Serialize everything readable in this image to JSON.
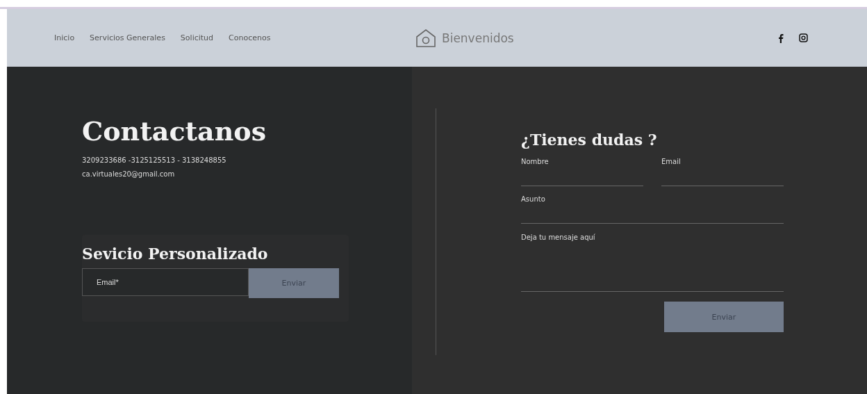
{
  "nav": {
    "links": [
      {
        "label": "Inicio"
      },
      {
        "label": "Servicios Generales"
      },
      {
        "label": "Solicitud"
      },
      {
        "label": "Conocenos"
      }
    ],
    "brand": "Bienvenidos"
  },
  "contact": {
    "title": "Contactanos",
    "phones": "3209233686 -3125125513 - 3138248855",
    "email": "ca.virtuales20@gmail.com"
  },
  "subscribe": {
    "title": "Sevicio Personalizado",
    "placeholder": "Email*",
    "button": "Enviar"
  },
  "form": {
    "title": "¿Tienes dudas ?",
    "fields": [
      {
        "placeholder": "Nombre",
        "kind": "half"
      },
      {
        "placeholder": "Email",
        "kind": "half"
      },
      {
        "placeholder": "Asunto",
        "kind": "full"
      },
      {
        "placeholder": "Deja tu mensaje aquí",
        "kind": "area"
      }
    ],
    "button": "Enviar"
  }
}
